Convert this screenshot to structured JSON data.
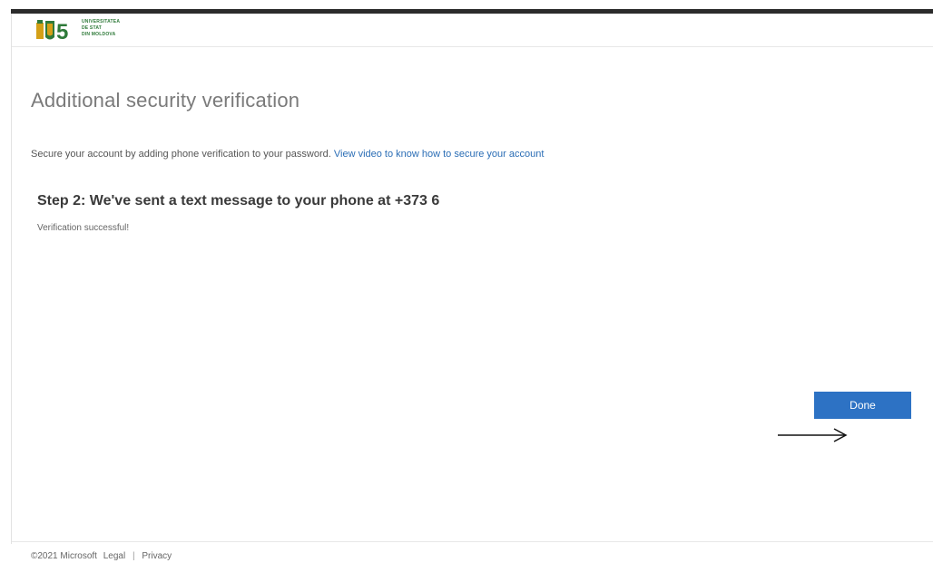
{
  "header": {
    "logo": {
      "lines": [
        "UNIVERSITATEA",
        "DE STAT",
        "DIN MOLDOVA"
      ],
      "emblem_number": "5",
      "emblem_icon": "university-crest-icon",
      "colors": {
        "green": "#2f7a3a",
        "gold": "#d4a017"
      }
    }
  },
  "main": {
    "title": "Additional security verification",
    "intro_text": "Secure your account by adding phone verification to your password.",
    "intro_link": "View video to know how to secure your account",
    "step_heading": "Step 2: We've sent a text message to your phone at +373 6",
    "status_message": "Verification successful!",
    "done_label": "Done"
  },
  "annotation": {
    "icon": "right-arrow-icon"
  },
  "footer": {
    "copyright": "©2021 Microsoft",
    "legal": "Legal",
    "separator": "|",
    "privacy": "Privacy"
  },
  "colors": {
    "accent": "#2d72c4",
    "link": "#2a6db5",
    "top_bar": "#2b2b2b"
  }
}
